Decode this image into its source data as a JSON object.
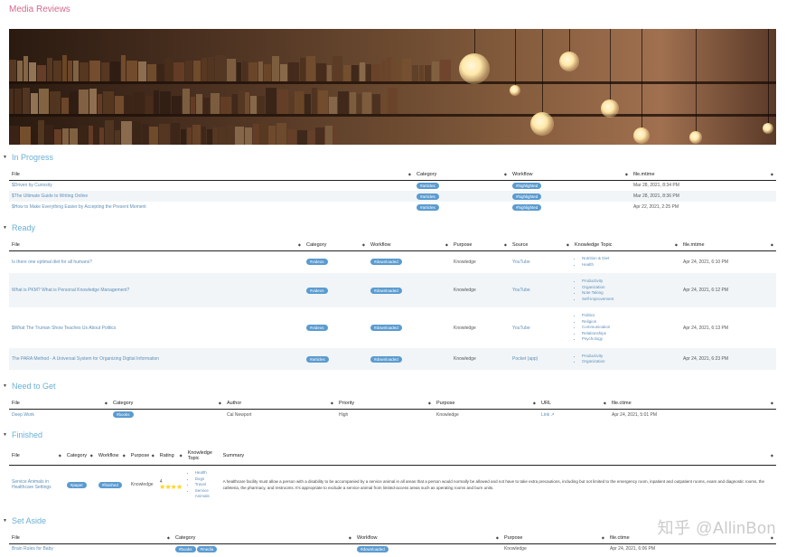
{
  "page": {
    "title": "Media Reviews"
  },
  "sections": {
    "in_progress": {
      "title": "In Progress",
      "headers": [
        "File",
        "Category",
        "Workflow",
        "file.mtime"
      ],
      "rows": [
        {
          "file": "$Driven by Curiosity",
          "category": "#articles",
          "workflow": "#highlighted",
          "mtime": "Mar 28, 2021, 8:34 PM"
        },
        {
          "file": "$The Ultimate Guide to Writing Online",
          "category": "#articles",
          "workflow": "#highlighted",
          "mtime": "Mar 28, 2021, 8:36 PM"
        },
        {
          "file": "$How to Make Everything Easier by Accepting the Present Moment",
          "category": "#articles",
          "workflow": "#highlighted",
          "mtime": "Apr 22, 2021, 2:25 PM"
        }
      ]
    },
    "ready": {
      "title": "Ready",
      "headers": [
        "File",
        "Category",
        "Workflow",
        "Purpose",
        "Source",
        "Knowledge Topic",
        "file.mtime"
      ],
      "rows": [
        {
          "file": "Is there one optimal diet for all humans?",
          "category": "#videos",
          "workflow": "#downloaded",
          "purpose": "Knowledge",
          "source": "YouTube",
          "topics": [
            "Nutrition & Diet",
            "Health"
          ],
          "mtime": "Apr 24, 2021, 6:10 PM"
        },
        {
          "file": "What is PKM? What is Personal Knowledge Management?",
          "category": "#videos",
          "workflow": "#downloaded",
          "purpose": "Knowledge",
          "source": "YouTube",
          "topics": [
            "Productivity",
            "Organization",
            "Note Taking",
            "Self-improvement"
          ],
          "mtime": "Apr 24, 2021, 6:12 PM"
        },
        {
          "file": "$What The Truman Show Teaches Us About Politics",
          "category": "#videos",
          "workflow": "#downloaded",
          "purpose": "Knowledge",
          "source": "YouTube",
          "topics": [
            "Politics",
            "Religion",
            "Communication",
            "Relationships",
            "Psychology"
          ],
          "mtime": "Apr 24, 2021, 6:13 PM"
        },
        {
          "file": "The PARA Method - A Universal System for Organizing Digital Information",
          "category": "#articles",
          "workflow": "#downloaded",
          "purpose": "Knowledge",
          "source": "Pocket (app)",
          "topics": [
            "Productivity",
            "Organization"
          ],
          "mtime": "Apr 24, 2021, 6:23 PM"
        }
      ]
    },
    "need_to_get": {
      "title": "Need to Get",
      "headers": [
        "File",
        "Category",
        "Author",
        "Priority",
        "Purpose",
        "URL",
        "file.ctime"
      ],
      "rows": [
        {
          "file": "Deep Work",
          "category": "#books",
          "author": "Cal Newport",
          "priority": "High",
          "purpose": "Knowledge",
          "url": "Link ↗",
          "ctime": "Apr 24, 2021, 5:01 PM"
        }
      ]
    },
    "finished": {
      "title": "Finished",
      "headers": [
        "File",
        "Category",
        "Workflow",
        "Purpose",
        "Rating",
        "Knowledge Topic",
        "Summary"
      ],
      "rows": [
        {
          "file": "Service Animals in Healthcare Settings",
          "category": "#paper",
          "workflow": "#finished",
          "purpose": "Knowledge",
          "rating_value": "4",
          "rating_stars": "⭐⭐⭐⭐",
          "topics": [
            "Health",
            "Dogs",
            "Travel",
            "Service Animals"
          ],
          "summary": "A healthcare facility must allow a person with a disability to be accompanied by a service animal in all areas that a person would normally be allowed and not have to take extra precautions, including but not limited to the emergency room, inpatient and outpatient rooms, exam and diagnostic rooms, the cafeteria, the pharmacy, and restrooms. It's appropriate to exclude a service animal from limited-access areas such as operating rooms and burn units."
        }
      ]
    },
    "set_aside": {
      "title": "Set Aside",
      "headers": [
        "File",
        "Category",
        "Workflow",
        "Purpose",
        "file.ctime"
      ],
      "rows": [
        {
          "file": "Brain Rules for Baby",
          "categories": [
            "#books",
            "#media"
          ],
          "workflow": "#downloaded",
          "purpose": "Knowledge",
          "ctime": "Apr 24, 2021, 6:06 PM"
        }
      ]
    }
  },
  "icons": {
    "section_toggle": "caret-down-icon",
    "sort": "sort-arrow-icon"
  },
  "colors": {
    "title": "#d36a8e",
    "section": "#6ab0d4",
    "tag": "#5a9bd0",
    "link": "#5f8fb6"
  },
  "watermark": "知乎 @AllinBon"
}
